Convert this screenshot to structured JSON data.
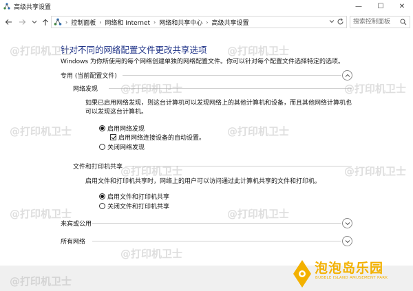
{
  "window": {
    "title": "高级共享设置",
    "minimize": "—",
    "maximize": "☐",
    "close": "✕"
  },
  "nav": {
    "breadcrumbs": [
      "控制面板",
      "网络和 Internet",
      "网络和共享中心",
      "高级共享设置"
    ],
    "search_placeholder": "搜索控制面板"
  },
  "content": {
    "heading": "针对不同的网络配置文件更改共享选项",
    "description": "Windows 为你所使用的每个网络创建单独的网络配置文件。你可以针对每个配置文件选择特定的选项。",
    "private_profile": {
      "title": "专用 (当前配置文件)",
      "network_discovery": {
        "title": "网络发现",
        "description_line1": "如果已启用网络发现，则这台计算机可以发现网络上的其他计算机和设备，而且其他网络计算机也",
        "description_line2": "可以发现这台计算机。",
        "option_on": "启用网络发现",
        "auto_setup": "启用网络连接设备的自动设置。",
        "option_off": "关闭网络发现",
        "selected": "on",
        "auto_setup_checked": true
      },
      "file_printer_sharing": {
        "title": "文件和打印机共享",
        "description": "启用文件和打印机共享时，网络上的用户可以访问通过此计算机共享的文件和打印机。",
        "option_on": "启用文件和打印机共享",
        "option_off": "关闭文件和打印机共享",
        "selected": "on"
      }
    },
    "guest_public": {
      "title": "来宾或公用"
    },
    "all_networks": {
      "title": "所有网络"
    }
  },
  "watermark": {
    "text": "@打印机卫士"
  },
  "brand": {
    "name": "泡泡岛乐园",
    "subtitle": "BUBBLE ISLAND AMUSEMENT PARK"
  },
  "colors": {
    "heading": "#1e3287",
    "brand": "#f3b100"
  },
  "icons": {
    "back": "arrow-left-icon",
    "forward": "arrow-right-icon",
    "up": "arrow-up-icon",
    "refresh": "refresh-icon",
    "search": "search-icon",
    "expand": "chevron-icon"
  }
}
